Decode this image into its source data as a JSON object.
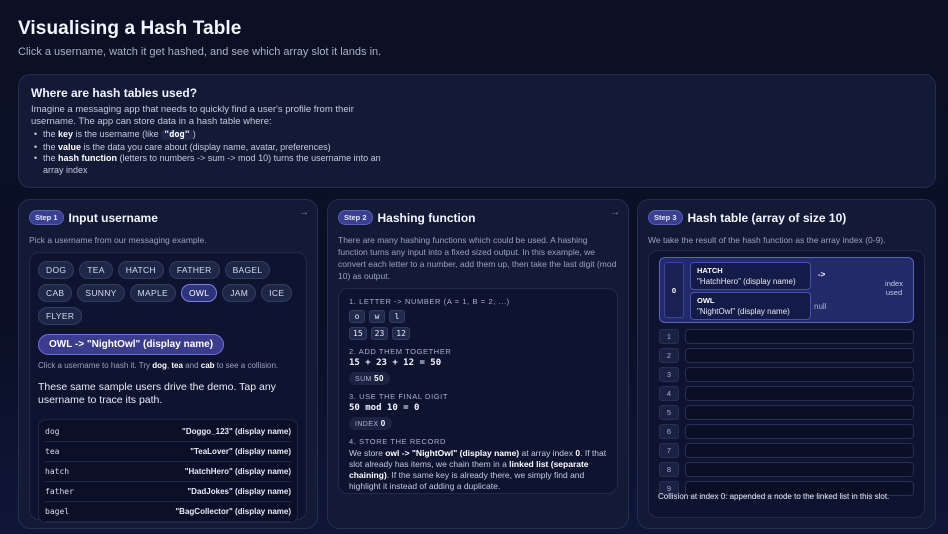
{
  "header": {
    "title": "Visualising a Hash Table",
    "subtitle": "Click a username, watch it get hashed, and see which array slot it lands in."
  },
  "info": {
    "heading": "Where are hash tables used?",
    "intro": "Imagine a messaging app that needs to quickly find a user's profile from their username. The app can store data in a hash table where:",
    "bullet_key_pre": "the ",
    "bullet_key_bold": "key",
    "bullet_key_mid": " is the username (like ",
    "bullet_key_code": "\"dog\"",
    "bullet_key_post": ")",
    "bullet_value_pre": "the ",
    "bullet_value_bold": "value",
    "bullet_value_post": " is the data you care about (display name, avatar, preferences)",
    "bullet_hash_pre": "the ",
    "bullet_hash_bold": "hash function",
    "bullet_hash_post": " (letters to numbers -> sum -> mod 10) turns the username into an array index"
  },
  "step1": {
    "badge": "Step 1",
    "title": "Input username",
    "desc": "Pick a username from our messaging example.",
    "chips": [
      "DOG",
      "TEA",
      "HATCH",
      "FATHER",
      "BAGEL",
      "CAB",
      "SUNNY",
      "MAPLE",
      "OWL",
      "JAM",
      "ICE",
      "FLYER"
    ],
    "active_chip": "OWL",
    "result": "OWL -> \"NightOwl\" (display name)",
    "hint_pre": "Click a username to hash it. Try ",
    "hint_dog": "dog",
    "hint_comma": ", ",
    "hint_tea": "tea",
    "hint_and": " and ",
    "hint_cab": "cab",
    "hint_post": " to see a collision.",
    "sample_note": "These same sample users drive the demo. Tap any username to trace its path.",
    "users": [
      {
        "key": "dog",
        "value": "\"Doggo_123\" (display name)"
      },
      {
        "key": "tea",
        "value": "\"TeaLover\" (display name)"
      },
      {
        "key": "hatch",
        "value": "\"HatchHero\" (display name)"
      },
      {
        "key": "father",
        "value": "\"DadJokes\" (display name)"
      },
      {
        "key": "bagel",
        "value": "\"BagCollector\" (display name)"
      }
    ]
  },
  "step2": {
    "badge": "Step 2",
    "title": "Hashing function",
    "desc": "There are many hashing functions which could be used. A hashing function turns any input into a fixed sized output. In this example, we convert each letter to a number, add them up, then take the last digit (mod 10) as output.",
    "s1_label": "1. LETTER -> NUMBER (A = 1, B = 2, ...)",
    "letters": [
      "o",
      "w",
      "l"
    ],
    "numbers": [
      "15",
      "23",
      "12"
    ],
    "s2_label": "2. ADD THEM TOGETHER",
    "sum_expr": "15 + 23 + 12 = 50",
    "sum_tag": "SUM",
    "sum_value": "50",
    "s3_label": "3. USE THE FINAL DIGIT",
    "mod_expr": "50 mod 10 = 0",
    "index_tag": "INDEX",
    "index_value": "0",
    "s4_label": "4. STORE THE RECORD",
    "store_1": "We store ",
    "store_2": "owl -> \"NightOwl\" (display name)",
    "store_3": " at array index ",
    "store_4": "0",
    "store_5": ". If that slot already has items, we chain them in a ",
    "store_6": "linked list (separate chaining)",
    "store_7": ". If the same key is already there, we simply find and highlight it instead of adding a duplicate."
  },
  "step3": {
    "badge": "Step 3",
    "title": "Hash table (array of size 10)",
    "desc": "We take the result of the hash function as the array index (0-9).",
    "slot0_index": "0",
    "chain": [
      {
        "key": "HATCH",
        "value": "\"HatchHero\" (display name)"
      },
      {
        "key": "OWL",
        "value": "\"NightOwl\" (display name)"
      }
    ],
    "arrow": "->",
    "null_label": "null",
    "index_used": "index used",
    "slots": [
      "1",
      "2",
      "3",
      "4",
      "5",
      "6",
      "7",
      "8",
      "9"
    ],
    "collision": "Collision at index 0: appended a node to the linked list in this slot."
  },
  "colors": {
    "accent": "#5a60c8",
    "background": "#0b1024",
    "card": "#131a36"
  }
}
